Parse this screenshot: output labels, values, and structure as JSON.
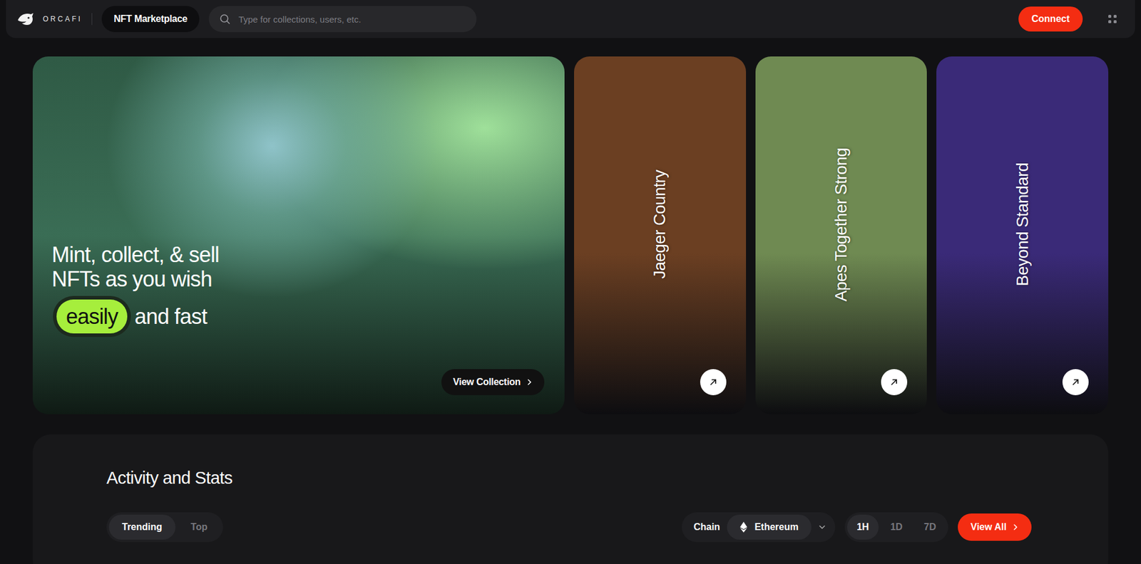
{
  "brand": {
    "name": "ORCAFI"
  },
  "nav": {
    "label": "NFT Marketplace"
  },
  "search": {
    "placeholder": "Type for collections, users, etc."
  },
  "connect_button": {
    "label": "Connect"
  },
  "hero": {
    "lines": [
      "Mint, collect, & sell",
      "NFTs as you wish"
    ],
    "highlight": "easily",
    "tail": "and fast",
    "button": "View Collection"
  },
  "collections": [
    {
      "name": "Jaeger Country",
      "color": "#6b3f22"
    },
    {
      "name": "Apes Together Strong",
      "color": "#6f8a52"
    },
    {
      "name": "Beyond Standard",
      "color": "#3a2a78"
    }
  ],
  "stats": {
    "title": "Activity and Stats",
    "tabs": [
      {
        "label": "Trending",
        "selected": true
      },
      {
        "label": "Top",
        "selected": false
      }
    ],
    "chain": {
      "label": "Chain",
      "value": "Ethereum"
    },
    "periods": [
      {
        "label": "1H",
        "selected": true
      },
      {
        "label": "1D",
        "selected": false
      },
      {
        "label": "7D",
        "selected": false
      }
    ],
    "view_all": "View All"
  }
}
